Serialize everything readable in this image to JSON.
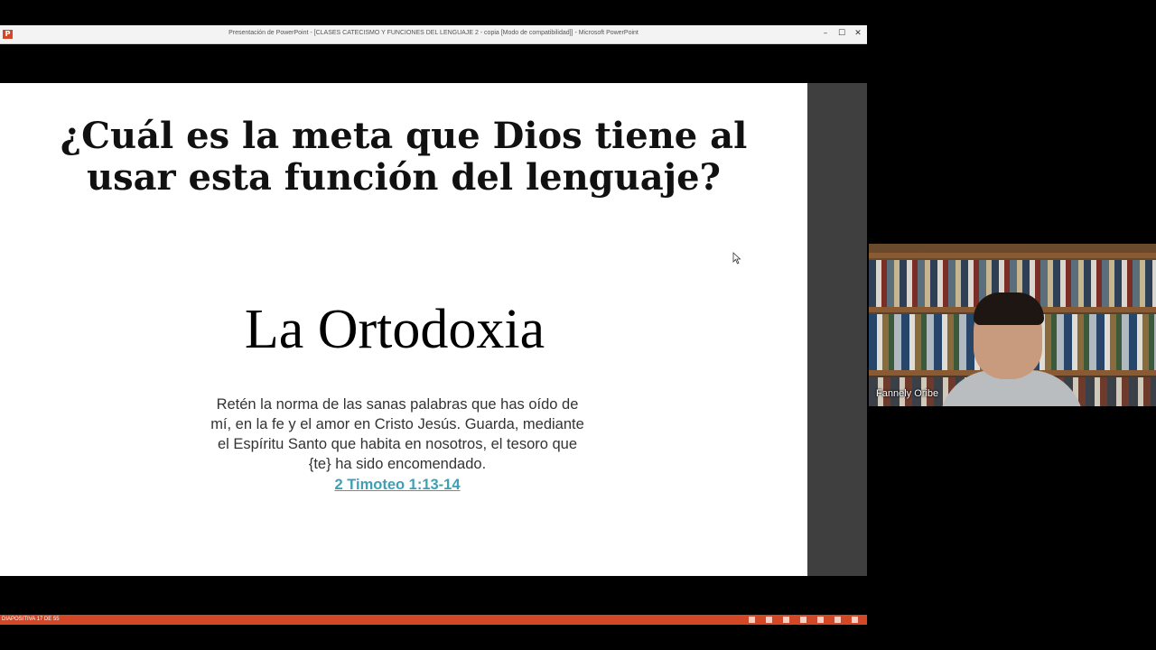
{
  "window": {
    "title": "Presentación de PowerPoint - [CLASES CATECISMO Y FUNCIONES DEL LENGUAJE 2 - copia [Modo de compatibilidad]] - Microsoft PowerPoint",
    "app_icon": "powerpoint-icon",
    "minimize_label": "–",
    "maximize_label": "☐",
    "close_label": "✕"
  },
  "slide": {
    "title_line1": "¿Cuál es la meta que Dios tiene al",
    "title_line2": "usar esta función del lenguaje?",
    "heading": "La Ortodoxia",
    "verse_lines": [
      "Retén la norma de las sanas palabras que has oído de",
      "mí, en la fe y el amor en Cristo Jesús. Guarda, mediante",
      "el Espíritu Santo que habita en nosotros, el tesoro que",
      "{te} ha sido encomendado."
    ],
    "verse_reference": " 2 Timoteo 1:13-14"
  },
  "statusbar": {
    "slide_counter": "DIAPOSITIVA 17 DE 55",
    "color": "#d24726"
  },
  "webcam": {
    "participant_name": "Fannely Oribe"
  },
  "colors": {
    "accent": "#d24726",
    "link": "#3f9fb3"
  }
}
